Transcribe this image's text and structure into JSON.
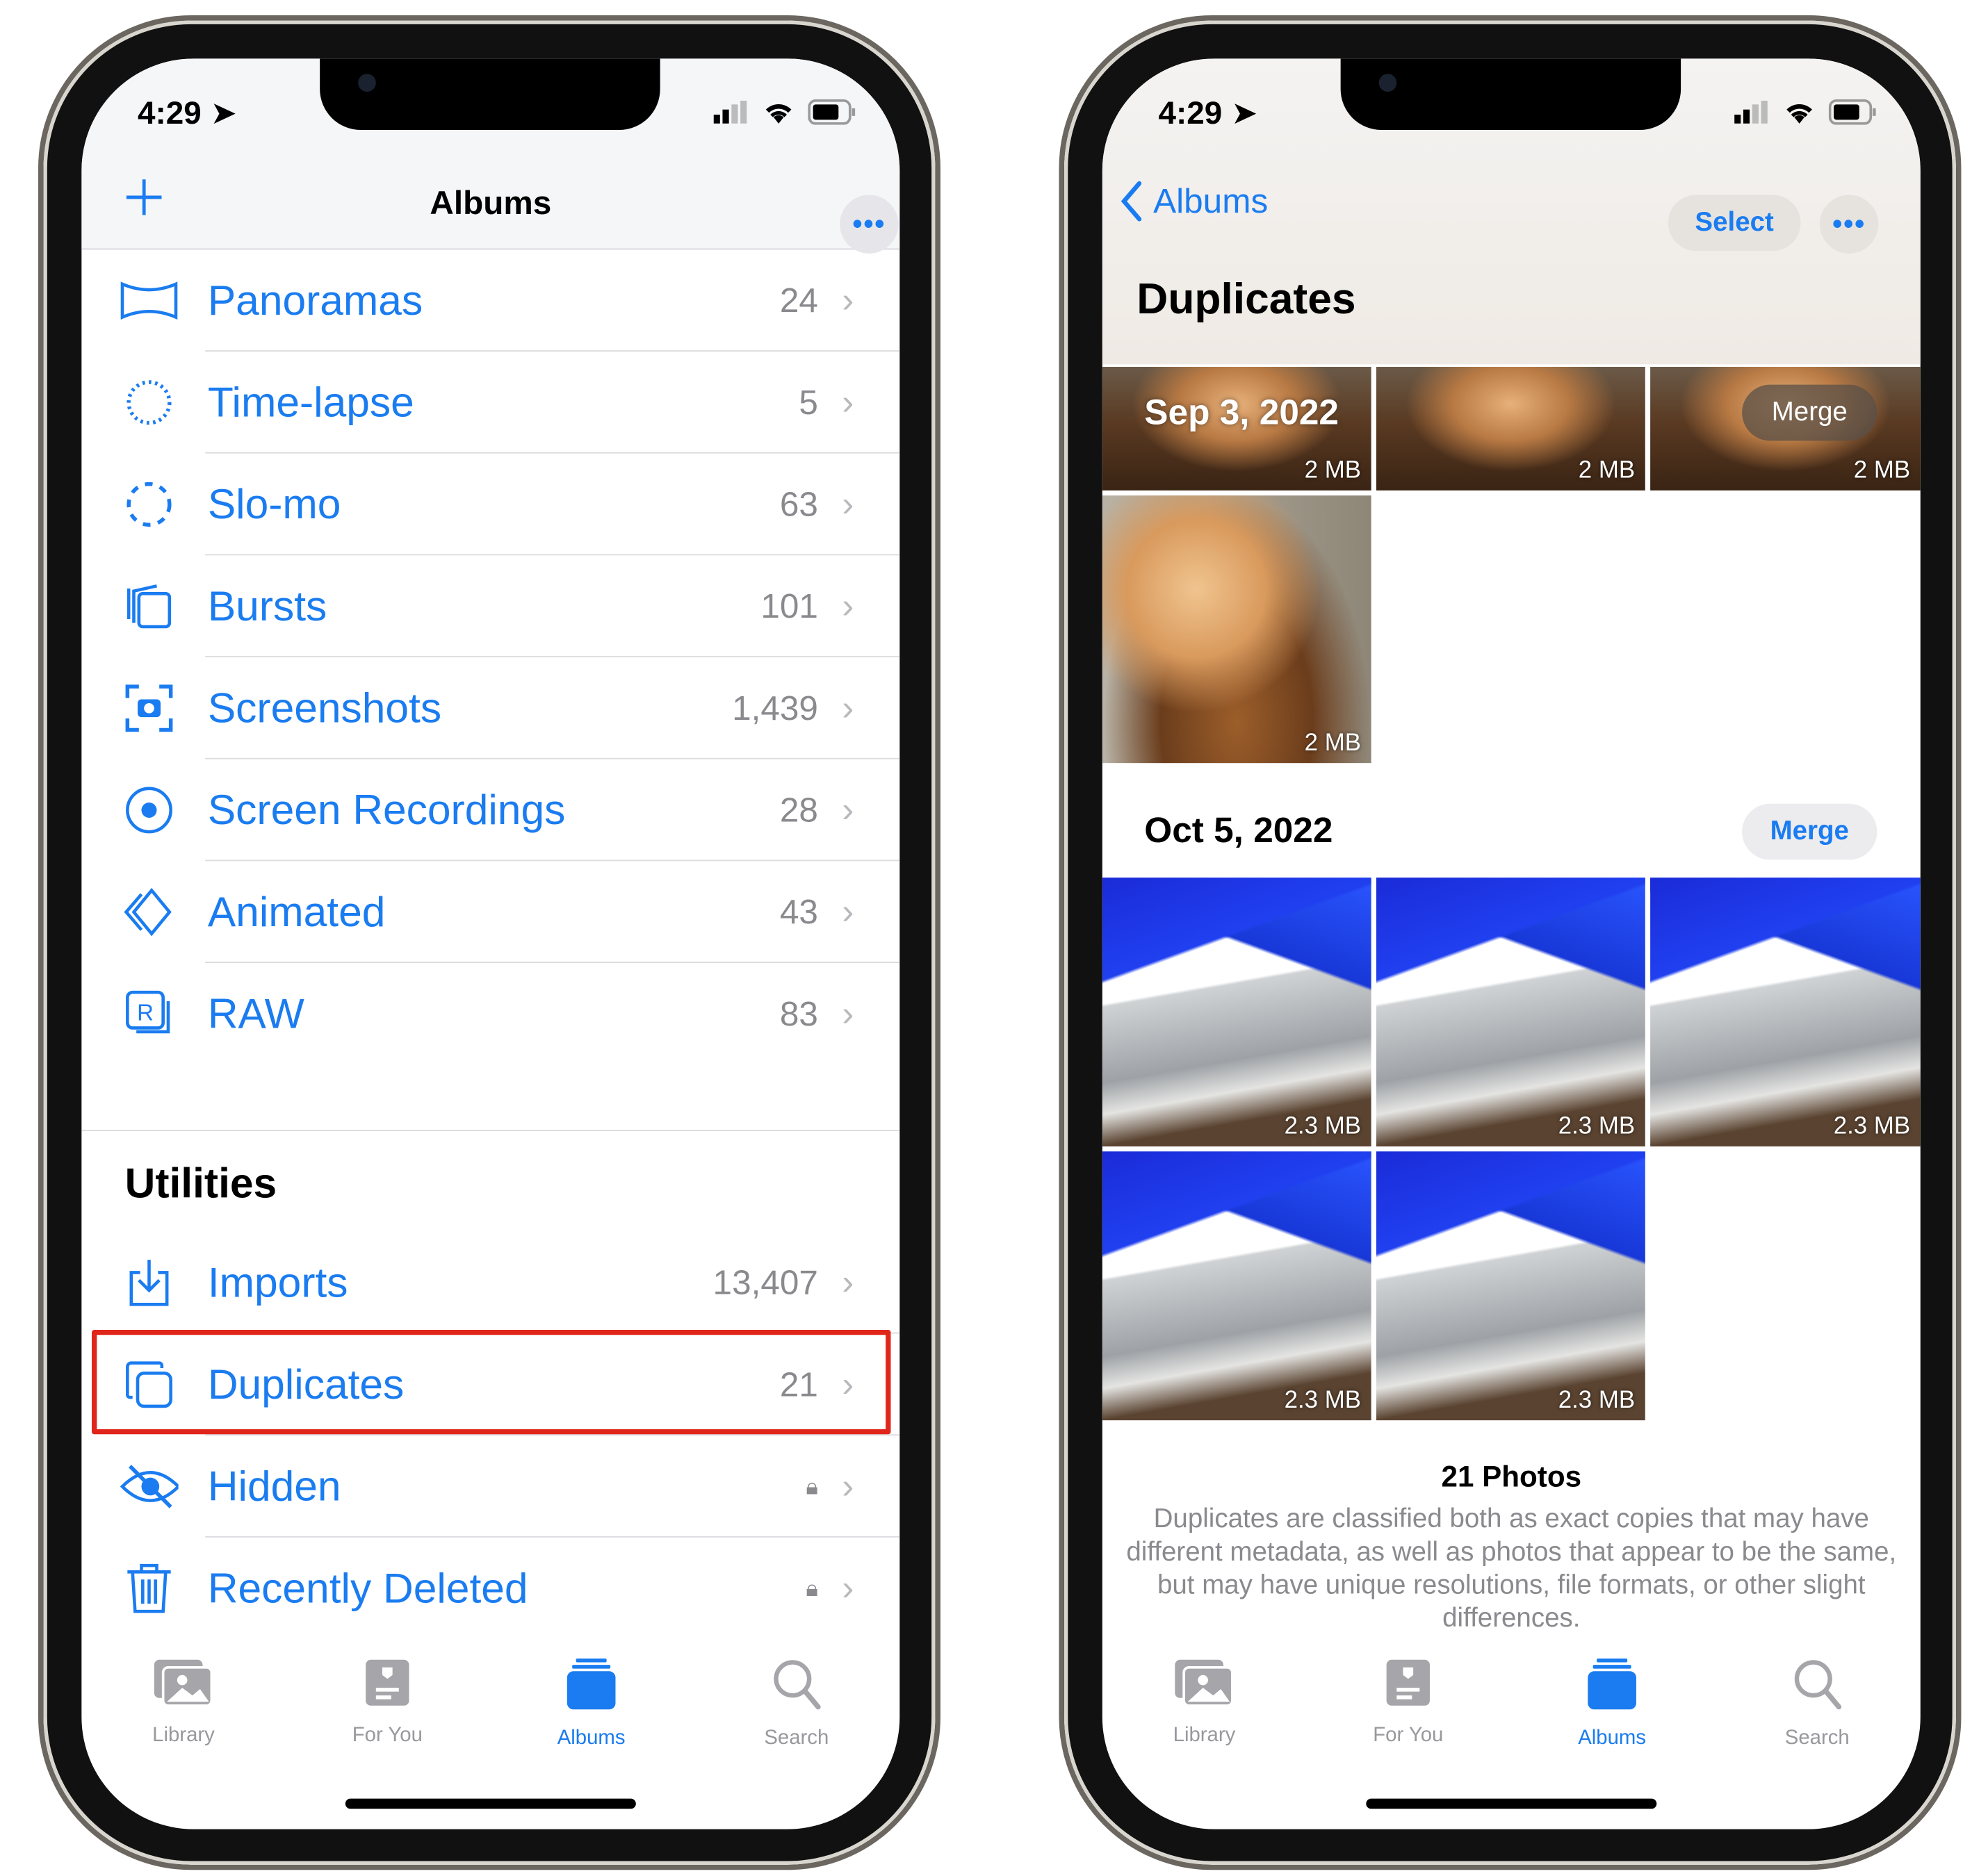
{
  "status": {
    "time": "4:29"
  },
  "left": {
    "nav": {
      "title": "Albums",
      "add_icon": "plus-icon",
      "more_icon": "ellipsis-icon"
    },
    "media_types": [
      {
        "label": "Panoramas",
        "count": "24",
        "icon": "panorama-icon"
      },
      {
        "label": "Time-lapse",
        "count": "5",
        "icon": "timelapse-icon"
      },
      {
        "label": "Slo-mo",
        "count": "63",
        "icon": "slomo-icon"
      },
      {
        "label": "Bursts",
        "count": "101",
        "icon": "bursts-icon"
      },
      {
        "label": "Screenshots",
        "count": "1,439",
        "icon": "screenshot-icon"
      },
      {
        "label": "Screen Recordings",
        "count": "28",
        "icon": "record-icon"
      },
      {
        "label": "Animated",
        "count": "43",
        "icon": "animated-icon"
      },
      {
        "label": "RAW",
        "count": "83",
        "icon": "raw-icon"
      }
    ],
    "utilities_heading": "Utilities",
    "utilities": [
      {
        "label": "Imports",
        "count": "13,407",
        "icon": "import-icon"
      },
      {
        "label": "Duplicates",
        "count": "21",
        "icon": "duplicates-icon",
        "highlighted": true
      },
      {
        "label": "Hidden",
        "count": "",
        "icon": "eye-slash-icon",
        "locked": true
      },
      {
        "label": "Recently Deleted",
        "count": "",
        "icon": "trash-icon",
        "locked": true
      }
    ],
    "highlight_color": "#e0261b"
  },
  "right": {
    "nav": {
      "back_label": "Albums",
      "select_label": "Select",
      "title": "Duplicates"
    },
    "groups": [
      {
        "date": "Sep 3, 2022",
        "merge_label": "Merge",
        "photos": [
          "2 MB",
          "2 MB",
          "2 MB",
          "2 MB"
        ]
      },
      {
        "date": "Oct 5, 2022",
        "merge_label": "Merge",
        "photos": [
          "2.3 MB",
          "2.3 MB",
          "2.3 MB",
          "2.3 MB",
          "2.3 MB"
        ]
      }
    ],
    "footer": {
      "count": "21 Photos",
      "description": "Duplicates are classified both as exact copies that may have different metadata, as well as photos that appear to be the same, but may have unique resolutions, file formats, or other slight differences."
    }
  },
  "tabs": [
    {
      "label": "Library",
      "icon": "photos-stack-icon"
    },
    {
      "label": "For You",
      "icon": "for-you-icon"
    },
    {
      "label": "Albums",
      "icon": "albums-icon",
      "active": true
    },
    {
      "label": "Search",
      "icon": "search-icon"
    }
  ],
  "colors": {
    "accent": "#1a7cf0",
    "secondary_text": "#8a8a8e"
  }
}
